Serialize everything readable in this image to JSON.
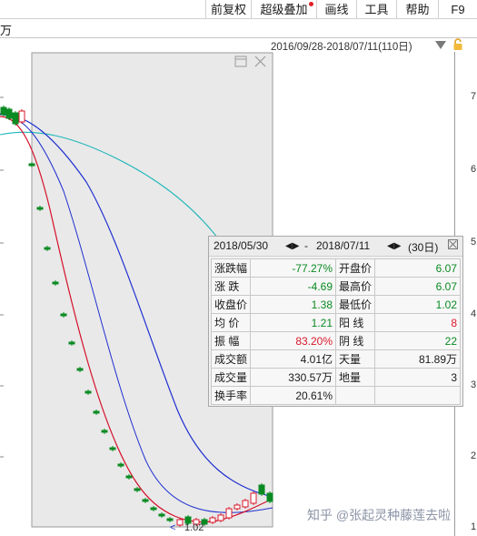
{
  "toolbar": {
    "items": [
      "前复权",
      "超级叠加",
      "画线",
      "工具",
      "帮助",
      "F9"
    ]
  },
  "subbar": {
    "label": "万"
  },
  "range": {
    "label": "2016/09/28-2018/07/11(110日)"
  },
  "y_axis": {
    "ticks": [
      "7",
      "6",
      "5",
      "4",
      "3",
      "2",
      "1"
    ]
  },
  "low_marker": "1.02",
  "stats": {
    "date_from": "2018/05/30",
    "sep": "-",
    "date_to": "2018/07/11",
    "days": "(30日)",
    "rows": [
      {
        "l1": "涨跌幅",
        "v1": "-77.27%",
        "l2": "开盘价",
        "v2": "6.07"
      },
      {
        "l1": "涨  跌",
        "v1": "-4.69",
        "l2": "最高价",
        "v2": "6.07"
      },
      {
        "l1": "收盘价",
        "v1": "1.38",
        "l2": "最低价",
        "v2": "1.02"
      },
      {
        "l1": "均  价",
        "v1": "1.21",
        "l2": "阳  线",
        "v2": "8"
      },
      {
        "l1": "振  幅",
        "v1": "83.20%",
        "l2": "阴  线",
        "v2": "22"
      },
      {
        "l1": "成交额",
        "v1": "4.01亿",
        "l2": "天量",
        "v2": "81.89万"
      },
      {
        "l1": "成交量",
        "v1": "330.57万",
        "l2": "地量",
        "v2": "3"
      },
      {
        "l1": "换手率",
        "v1": "20.61%",
        "l2": "",
        "v2": ""
      }
    ]
  },
  "watermark": "知乎 @张起灵种藤莲去啦",
  "colors": {
    "up": "#d9192b",
    "down": "#0a8a22",
    "ma_blue": "#1f2fd0",
    "ma_red": "#d4102a",
    "ma_cyan": "#1fb6b8",
    "selection": "#e9e9e9"
  }
}
